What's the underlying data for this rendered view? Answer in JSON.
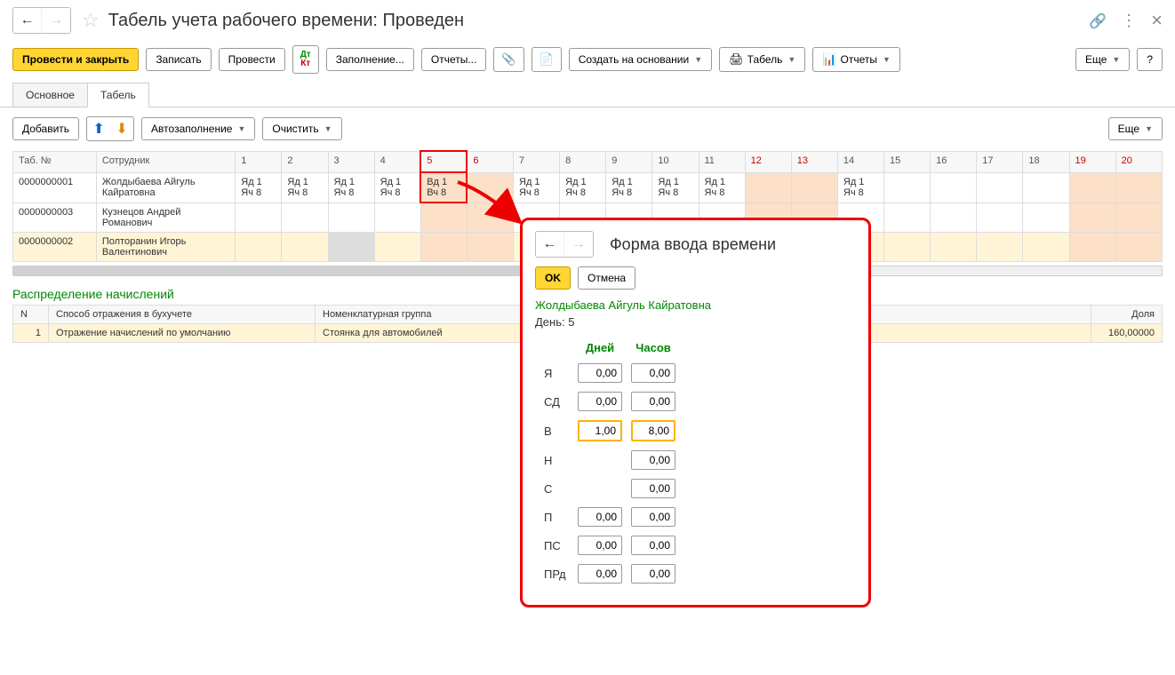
{
  "header": {
    "title": "Табель учета рабочего времени: Проведен"
  },
  "toolbar": {
    "post_close": "Провести и закрыть",
    "save": "Записать",
    "post": "Провести",
    "fill": "Заполнение...",
    "reports": "Отчеты...",
    "create_based": "Создать на основании",
    "print_timesheet": "Табель",
    "print_reports": "Отчеты",
    "more": "Еще",
    "help": "?"
  },
  "tabs": {
    "main": "Основное",
    "timesheet": "Табель"
  },
  "actions": {
    "add": "Добавить",
    "autofill": "Автозаполнение",
    "clear": "Очистить",
    "more": "Еще"
  },
  "grid": {
    "col_num": "Таб. №",
    "col_emp": "Сотрудник",
    "days": [
      "1",
      "2",
      "3",
      "4",
      "5",
      "6",
      "7",
      "8",
      "9",
      "10",
      "11",
      "12",
      "13",
      "14",
      "15",
      "16",
      "17",
      "18",
      "19",
      "20"
    ],
    "weekend_idx": [
      4,
      5,
      11,
      12,
      18,
      19
    ],
    "rows": [
      {
        "num": "0000000001",
        "name": "Жолдыбаева Айгуль Кайратовна",
        "cells": [
          "Яд 1 Яч 8",
          "Яд 1 Яч 8",
          "Яд 1 Яч 8",
          "Яд 1 Яч 8",
          "Вд 1 Вч 8",
          "",
          "Яд 1 Яч 8",
          "Яд 1 Яч 8",
          "Яд 1 Яч 8",
          "Яд 1 Яч 8",
          "Яд 1 Яч 8",
          "",
          "",
          "Яд 1 Яч 8",
          "",
          "",
          "",
          "",
          "",
          ""
        ]
      },
      {
        "num": "0000000003",
        "name": "Кузнецов Андрей Романович",
        "cells": [
          "",
          "",
          "",
          "",
          "",
          "",
          "",
          "",
          "",
          "",
          "",
          "",
          "",
          "",
          "",
          "",
          "",
          "",
          "",
          ""
        ]
      },
      {
        "num": "0000000002",
        "name": "Полторанин Игорь Валентинович",
        "cells": [
          "",
          "",
          "",
          "",
          "",
          "",
          "",
          "",
          "",
          "",
          "",
          "",
          "",
          "",
          "",
          "",
          "",
          "",
          "",
          ""
        ]
      }
    ]
  },
  "section": {
    "title": "Распределение начислений"
  },
  "subgrid": {
    "cols": {
      "n": "N",
      "method": "Способ отражения в бухучете",
      "group": "Номенклатурная группа",
      "share": "Доля"
    },
    "row": {
      "n": "1",
      "method": "Отражение начислений по умолчанию",
      "group": "Стоянка для автомобилей",
      "share": "160,00000"
    }
  },
  "popup": {
    "title": "Форма ввода времени",
    "ok": "OK",
    "cancel": "Отмена",
    "employee": "Жолдыбаева Айгуль Кайратовна",
    "day_label": "День:",
    "day_value": "5",
    "col_days": "Дней",
    "col_hours": "Часов",
    "rows": [
      {
        "label": "Я",
        "days": "0,00",
        "hours": "0,00",
        "hl": false
      },
      {
        "label": "СД",
        "days": "0,00",
        "hours": "0,00",
        "hl": false
      },
      {
        "label": "В",
        "days": "1,00",
        "hours": "8,00",
        "hl": true
      },
      {
        "label": "Н",
        "days": "",
        "hours": "0,00",
        "hl": false
      },
      {
        "label": "С",
        "days": "",
        "hours": "0,00",
        "hl": false
      },
      {
        "label": "П",
        "days": "0,00",
        "hours": "0,00",
        "hl": false
      },
      {
        "label": "ПС",
        "days": "0,00",
        "hours": "0,00",
        "hl": false
      },
      {
        "label": "ПРд",
        "days": "0,00",
        "hours": "0,00",
        "hl": false
      }
    ]
  }
}
